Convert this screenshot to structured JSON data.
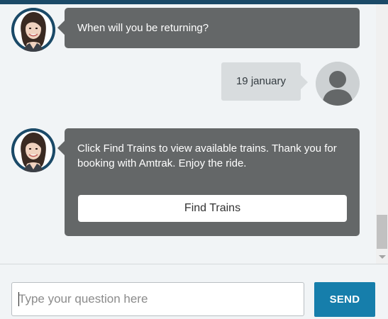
{
  "conversation": {
    "messages": [
      {
        "sender": "bot",
        "text": "When will you be returning?"
      },
      {
        "sender": "user",
        "text": "19 january"
      },
      {
        "sender": "bot",
        "text": "Click Find Trains to view available trains. Thank you for booking with Amtrak. Enjoy the ride.",
        "button_label": "Find Trains"
      }
    ]
  },
  "composer": {
    "placeholder": "Type your question here",
    "value": "",
    "send_label": "SEND"
  },
  "icons": {
    "agent_avatar": "agent-photo-avatar",
    "user_avatar": "user-silhouette-icon",
    "scroll_down": "chevron-down-icon"
  },
  "colors": {
    "header": "#1b4a68",
    "bot_bubble": "#646768",
    "user_bubble": "#d8dcde",
    "send_button": "#167eab",
    "background": "#f1f4f6"
  }
}
